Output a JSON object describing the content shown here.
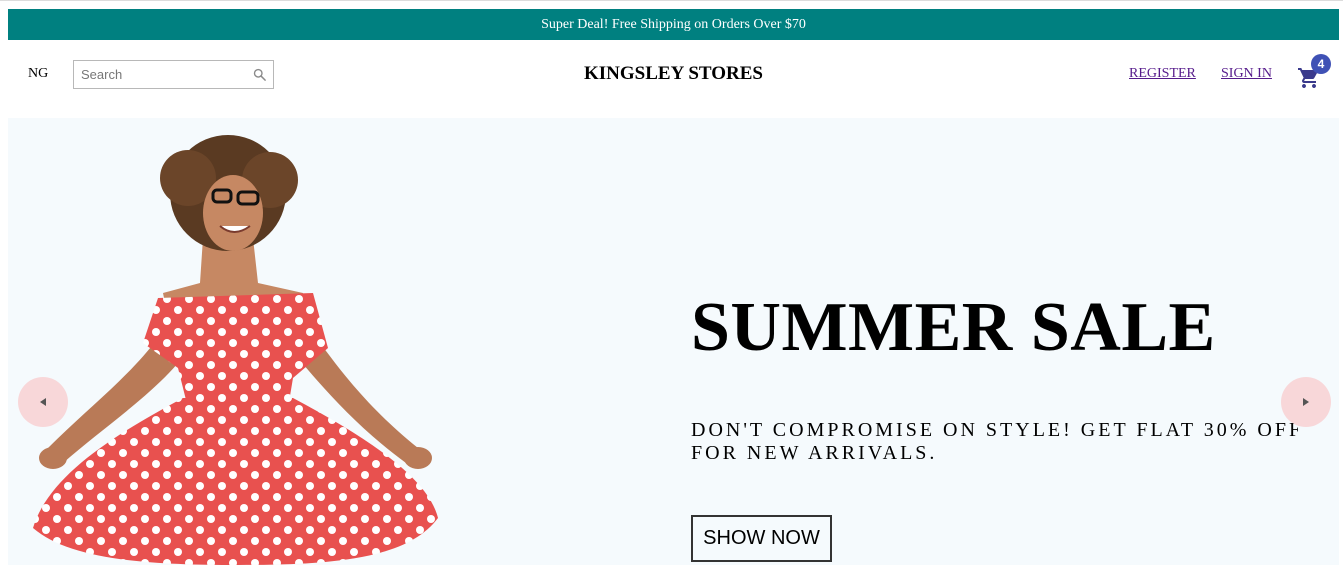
{
  "announcement": {
    "text": "Super Deal! Free Shipping on Orders Over $70"
  },
  "header": {
    "language": "NG",
    "search": {
      "placeholder": "Search",
      "value": ""
    },
    "brand": "KINGSLEY STORES",
    "links": {
      "register": "REGISTER",
      "sign_in": "SIGN IN"
    },
    "cart": {
      "count": "4"
    }
  },
  "hero": {
    "title": "SUMMER SALE",
    "description": "DON'T COMPROMISE ON STYLE! GET FLAT 30% OFF FOR NEW ARRIVALS.",
    "button_label": "SHOW NOW"
  },
  "icons": {
    "search": "search-icon",
    "cart": "shopping-cart-icon",
    "prev": "arrow-left-icon",
    "next": "arrow-right-icon"
  },
  "colors": {
    "announcement_bg": "#008080",
    "hero_bg": "#f5fafd",
    "badge": "#3f51b5",
    "arrow_bg": "#f8d7d9",
    "link": "#551a8b"
  }
}
